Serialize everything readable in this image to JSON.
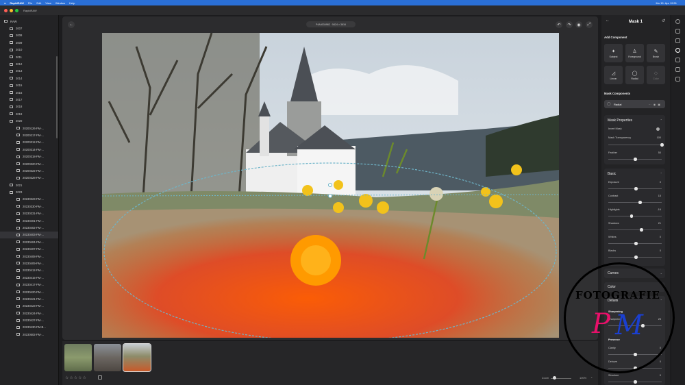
{
  "menubar": {
    "app": "RapidRAW",
    "items": [
      "File",
      "Edit",
      "View",
      "Window",
      "Help"
    ],
    "status": "Mo 15. Apr  19:51"
  },
  "window": {
    "title": "RapidRAW"
  },
  "folders": {
    "root": "RAW",
    "items": [
      {
        "label": "2007",
        "level": "top"
      },
      {
        "label": "2008",
        "level": "top"
      },
      {
        "label": "2009",
        "level": "top"
      },
      {
        "label": "2010",
        "level": "top"
      },
      {
        "label": "2011",
        "level": "top"
      },
      {
        "label": "2012",
        "level": "top"
      },
      {
        "label": "2013",
        "level": "top"
      },
      {
        "label": "2014",
        "level": "top"
      },
      {
        "label": "2015",
        "level": "top"
      },
      {
        "label": "2016",
        "level": "top"
      },
      {
        "label": "2017",
        "level": "top"
      },
      {
        "label": "2018",
        "level": "top"
      },
      {
        "label": "2019",
        "level": "top"
      },
      {
        "label": "2020",
        "level": "top"
      },
      {
        "label": "20200126-FM-...",
        "level": "sub"
      },
      {
        "label": "20200217-FM-...",
        "level": "sub"
      },
      {
        "label": "20200312-FM-...",
        "level": "sub"
      },
      {
        "label": "20200314-FM-...",
        "level": "sub"
      },
      {
        "label": "20200318-FM-...",
        "level": "sub"
      },
      {
        "label": "20200320-FM-...",
        "level": "sub"
      },
      {
        "label": "20200322-FM-...",
        "level": "sub"
      },
      {
        "label": "20200328-FM-...",
        "level": "sub"
      },
      {
        "label": "2021",
        "level": "top"
      },
      {
        "label": "2023",
        "level": "top"
      },
      {
        "label": "20230323-FM-...",
        "level": "sub"
      },
      {
        "label": "20230330-FM-...",
        "level": "sub"
      },
      {
        "label": "20230331-FM-...",
        "level": "sub"
      },
      {
        "label": "20230401-FM-...",
        "level": "sub"
      },
      {
        "label": "20230402-FM-...",
        "level": "sub"
      },
      {
        "label": "20230403-FM-...",
        "level": "sub",
        "selected": true
      },
      {
        "label": "20230404-FM-...",
        "level": "sub"
      },
      {
        "label": "20230407-FM-...",
        "level": "sub"
      },
      {
        "label": "20230408-FM-...",
        "level": "sub"
      },
      {
        "label": "20230409-FM-...",
        "level": "sub"
      },
      {
        "label": "20230412-FM-...",
        "level": "sub"
      },
      {
        "label": "20230415-FM-...",
        "level": "sub"
      },
      {
        "label": "20230417-FM-...",
        "level": "sub"
      },
      {
        "label": "20230420-FM-...",
        "level": "sub"
      },
      {
        "label": "20230421-FM-...",
        "level": "sub"
      },
      {
        "label": "20230423-FM-...",
        "level": "sub"
      },
      {
        "label": "20230424-FM-...",
        "level": "sub"
      },
      {
        "label": "20230427-FM-...",
        "level": "sub"
      },
      {
        "label": "20230430-FM-B...",
        "level": "sub"
      },
      {
        "label": "20230502-FM-...",
        "level": "sub"
      }
    ]
  },
  "viewer": {
    "filename": "P4A4034982  ·  5424 × 3616"
  },
  "filmstrip": {
    "rating": "☆☆☆☆☆",
    "zoom_label": "Zoom",
    "zoom_value": "100%"
  },
  "mask_panel": {
    "title": "Mask 1",
    "add_component_label": "Add Component",
    "components": [
      {
        "label": "Subject",
        "icon": "✦",
        "enabled": true
      },
      {
        "label": "Foreground",
        "icon": "♙",
        "enabled": true
      },
      {
        "label": "Brush",
        "icon": "✎",
        "enabled": true
      },
      {
        "label": "Linear",
        "icon": "◿",
        "enabled": true
      },
      {
        "label": "Radial",
        "icon": "◯",
        "enabled": true
      },
      {
        "label": "Color",
        "icon": "◇",
        "enabled": false
      }
    ],
    "mask_components_label": "Mask Components",
    "active_component": "Radial",
    "mask_properties": {
      "title": "Mask Properties",
      "invert_label": "Invert Mask",
      "transparency_label": "Mask Transparency",
      "transparency_value": "100",
      "feather_label": "Feather",
      "feather_value": "50"
    },
    "basic": {
      "title": "Basic",
      "sliders": [
        {
          "label": "Exposure",
          "value": "0",
          "fraction": 0.5
        },
        {
          "label": "Contrast",
          "value": "15",
          "fraction": 0.58
        },
        {
          "label": "Highlights",
          "value": "-16",
          "fraction": 0.42
        },
        {
          "label": "Shadows",
          "value": "21",
          "fraction": 0.61
        },
        {
          "label": "Whites",
          "value": "0",
          "fraction": 0.5
        },
        {
          "label": "Blacks",
          "value": "0",
          "fraction": 0.5
        }
      ]
    },
    "curves_title": "Curves",
    "color_title": "Color",
    "details": {
      "title": "Details",
      "sharpening_title": "Sharpening",
      "sharpness_label": "Sharpness",
      "sharpness_value": "25",
      "presence_title": "Presence",
      "clarity_label": "Clarity",
      "clarity_value": "0",
      "dehaze_label": "Dehaze",
      "dehaze_value": "0",
      "structure_label": "Structure",
      "structure_value": "0"
    }
  },
  "watermark": {
    "text": "FOTOGRAFIE",
    "initial_1": "P",
    "initial_2": "M"
  }
}
